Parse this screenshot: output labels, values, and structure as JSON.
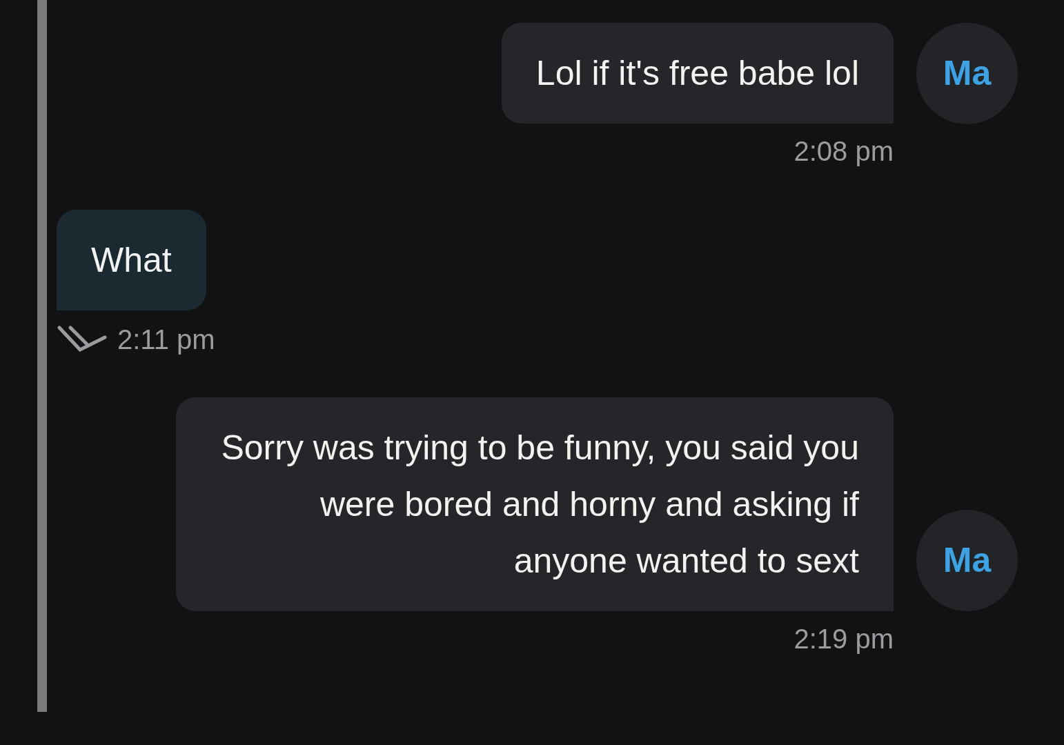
{
  "messages": [
    {
      "kind": "incoming",
      "avatar": "Ma",
      "text": "Lol if it's free babe lol",
      "time": "2:08 pm"
    },
    {
      "kind": "outgoing",
      "text": "What",
      "time": "2:11 pm",
      "read": true
    },
    {
      "kind": "incoming",
      "avatar": "Ma",
      "text": "Sorry was trying to be funny, you said you were bored and horny and asking if anyone wanted to sext",
      "time": "2:19 pm"
    }
  ]
}
